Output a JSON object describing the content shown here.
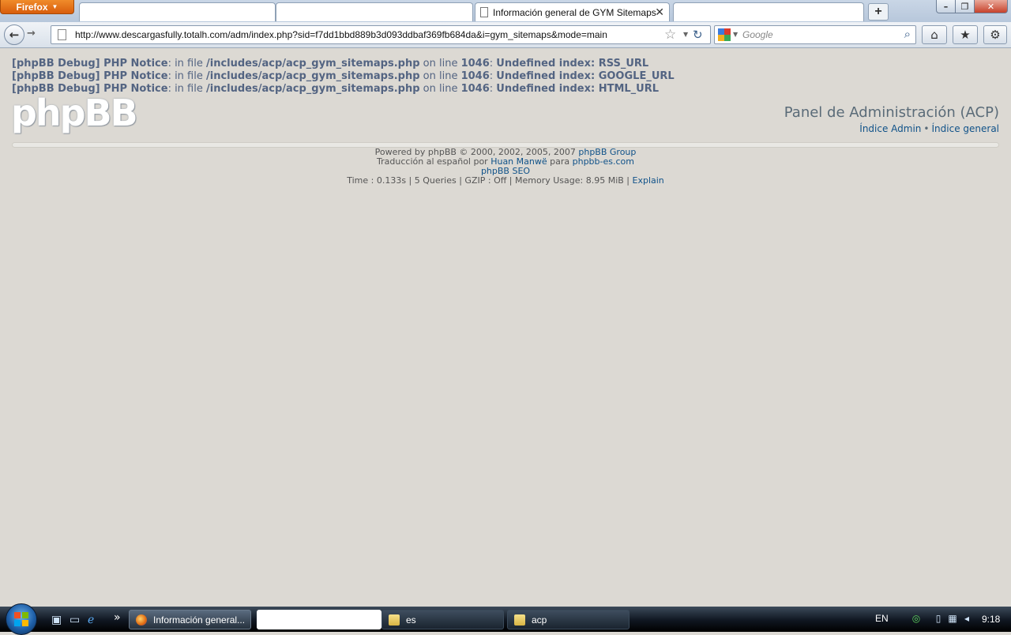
{
  "browser": {
    "menu_button": "Firefox",
    "tab_active": "Información general de GYM Sitemaps",
    "url": "http://www.descargasfully.totalh.com/adm/index.php?sid=f7dd1bbd889b3d093ddbaf369fb684da&i=gym_sitemaps&mode=main",
    "search_placeholder": "Google",
    "new_tab": "+"
  },
  "debug_notices": [
    {
      "prefix": "[phpBB Debug] PHP Notice",
      "in_file": ": in file ",
      "file": "/includes/acp/acp_gym_sitemaps.php",
      "on_line": " on line ",
      "line": "1046",
      "colon": ": ",
      "message": "Undefined index: RSS_URL"
    },
    {
      "prefix": "[phpBB Debug] PHP Notice",
      "in_file": ": in file ",
      "file": "/includes/acp/acp_gym_sitemaps.php",
      "on_line": " on line ",
      "line": "1046",
      "colon": ": ",
      "message": "Undefined index: GOOGLE_URL"
    },
    {
      "prefix": "[phpBB Debug] PHP Notice",
      "in_file": ": in file ",
      "file": "/includes/acp/acp_gym_sitemaps.php",
      "on_line": " on line ",
      "line": "1046",
      "colon": ": ",
      "message": "Undefined index: HTML_URL"
    }
  ],
  "header": {
    "logo": "phpBB",
    "title": "Panel de Administración (ACP)",
    "link_admin": "Índice Admin",
    "separator": "•",
    "link_general": "Índice general"
  },
  "footer": {
    "powered_text": "Powered by phpBB © 2000, 2002, 2005, 2007 ",
    "powered_link": "phpBB Group",
    "translation_text": "Traducción al español por ",
    "translator_link": "Huan Manwë",
    "translation_mid": " para ",
    "translation_site_link": "phpbb-es.com",
    "seo_link": "phpBB SEO",
    "stats_text": "Time : 0.133s | 5 Queries | GZIP : Off | Memory Usage: 8.95 MiB | ",
    "explain_link": "Explain"
  },
  "taskbar": {
    "task_firefox": "Información general...",
    "task_es": "es",
    "task_acp": "acp",
    "quicklaunch_more": "»",
    "language": "EN",
    "clock": "9:18"
  },
  "colors": {
    "page_bg": "#dcd9d3",
    "link": "#105289",
    "debug_text": "#536482"
  }
}
